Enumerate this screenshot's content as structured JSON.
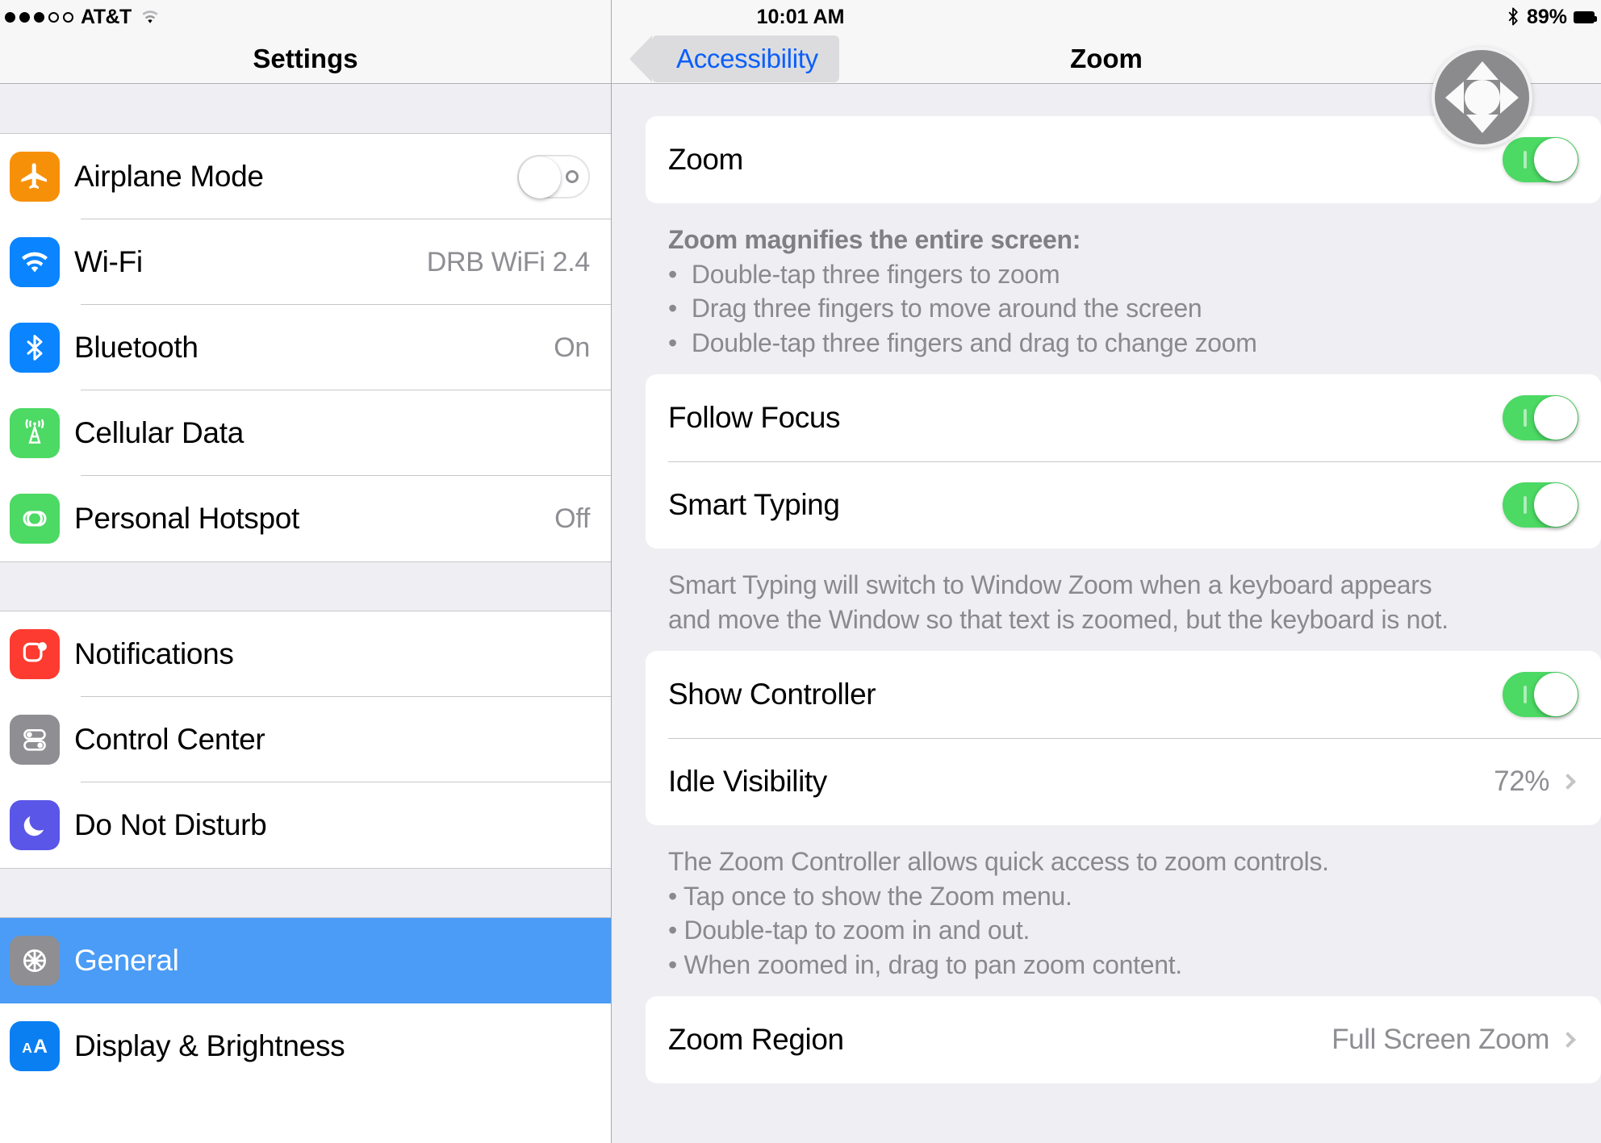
{
  "status_bar": {
    "signal_dots_filled": 3,
    "signal_dots_total": 5,
    "carrier": "AT&T",
    "wifi_icon": "wifi-icon",
    "time": "10:01 AM",
    "bluetooth_icon": "bluetooth-icon",
    "battery_percent": "89%"
  },
  "sidebar": {
    "title": "Settings",
    "groups": [
      {
        "items": [
          {
            "label": "Airplane Mode",
            "icon": "airplane-icon",
            "icon_color": "#f79009",
            "control": "toggle",
            "toggle_on": false
          },
          {
            "label": "Wi-Fi",
            "icon": "wifi-icon",
            "icon_color": "#0a84ff",
            "control": "value",
            "value": "DRB WiFi 2.4"
          },
          {
            "label": "Bluetooth",
            "icon": "bluetooth-icon",
            "icon_color": "#0a84ff",
            "control": "value",
            "value": "On"
          },
          {
            "label": "Cellular Data",
            "icon": "cellular-tower-icon",
            "icon_color": "#4cd964",
            "control": "none",
            "value": ""
          },
          {
            "label": "Personal Hotspot",
            "icon": "hotspot-link-icon",
            "icon_color": "#4cd964",
            "control": "value",
            "value": "Off"
          }
        ]
      },
      {
        "items": [
          {
            "label": "Notifications",
            "icon": "notifications-icon",
            "icon_color": "#fd3b30",
            "control": "none",
            "value": ""
          },
          {
            "label": "Control Center",
            "icon": "control-center-icon",
            "icon_color": "#8e8e93",
            "control": "none",
            "value": ""
          },
          {
            "label": "Do Not Disturb",
            "icon": "moon-icon",
            "icon_color": "#5a56e8",
            "control": "none",
            "value": ""
          }
        ]
      },
      {
        "items": [
          {
            "label": "General",
            "icon": "gear-icon",
            "icon_color": "#8e8e93",
            "control": "none",
            "value": "",
            "selected": true
          },
          {
            "label": "Display & Brightness",
            "icon": "text-size-icon",
            "icon_color": "#0a7ff2",
            "control": "none",
            "value": ""
          }
        ]
      }
    ],
    "selected_highlight_color": "#4a9cf6"
  },
  "detail": {
    "back_button": "Accessibility",
    "title": "Zoom",
    "zoom_controller_icon": "zoom-controller-dpad-icon",
    "rows": {
      "zoom": {
        "label": "Zoom",
        "toggle_on": true
      },
      "follow_focus": {
        "label": "Follow Focus",
        "toggle_on": true
      },
      "smart_typing": {
        "label": "Smart Typing",
        "toggle_on": true
      },
      "show_controller": {
        "label": "Show Controller",
        "toggle_on": true
      },
      "idle_visibility": {
        "label": "Idle Visibility",
        "value": "72%"
      },
      "zoom_region": {
        "label": "Zoom Region",
        "value": "Full Screen Zoom"
      }
    },
    "footnotes": {
      "zoom_head": "Zoom magnifies the entire screen:",
      "zoom_b1": "Double-tap three fingers to zoom",
      "zoom_b2": "Drag three fingers to move around the screen",
      "zoom_b3": "Double-tap three fingers and drag to change zoom",
      "smart_typing_line1": "Smart Typing will switch to Window Zoom when a keyboard appears",
      "smart_typing_line2": "and move the Window so that text is zoomed, but the keyboard is not.",
      "controller_head": "The Zoom Controller allows quick access to zoom controls.",
      "controller_b1": "• Tap once to show the Zoom menu.",
      "controller_b2": "• Double-tap to zoom in and out.",
      "controller_b3": "• When zoomed in, drag to pan zoom content."
    }
  },
  "colors": {
    "toggle_on": "#4cd964",
    "link_blue": "#0b5ff8",
    "selection_blue": "#4a9cf6",
    "panel_bg": "#efeef2"
  }
}
